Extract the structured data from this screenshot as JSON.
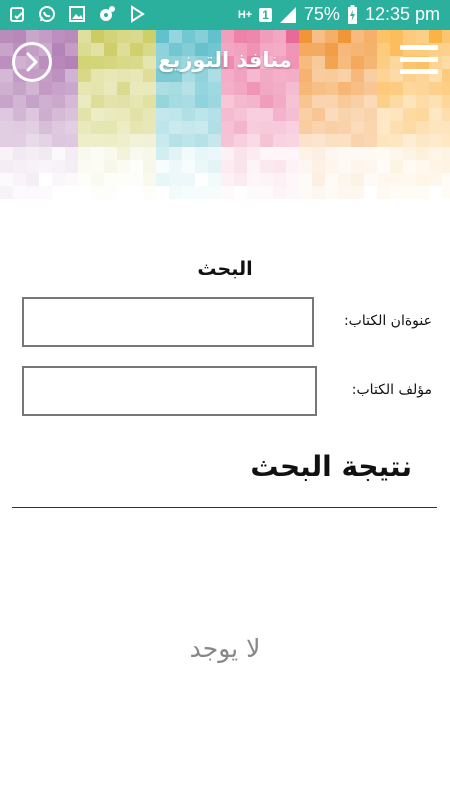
{
  "status_bar": {
    "battery_percent": "75%",
    "time": "12:35 pm",
    "sim_label": "1",
    "network_label": "H+",
    "left_icons": [
      "clipboard-icon",
      "whatsapp-icon",
      "gallery-icon",
      "settings-badge-icon",
      "play-store-icon"
    ]
  },
  "header": {
    "title": "منافذ التوزيع",
    "accent_colors": [
      "#a56aa8",
      "#c9c95a",
      "#48b6c4",
      "#e86494",
      "#f19434",
      "#fbb341"
    ]
  },
  "search": {
    "heading": "البحث",
    "book_title_label": "عنوةان الكتاب:",
    "book_title_value": "",
    "author_label": "مؤلف الكتاب:",
    "author_value": ""
  },
  "results": {
    "heading": "نتيجة البحث",
    "empty_text": "لا يوجد"
  }
}
